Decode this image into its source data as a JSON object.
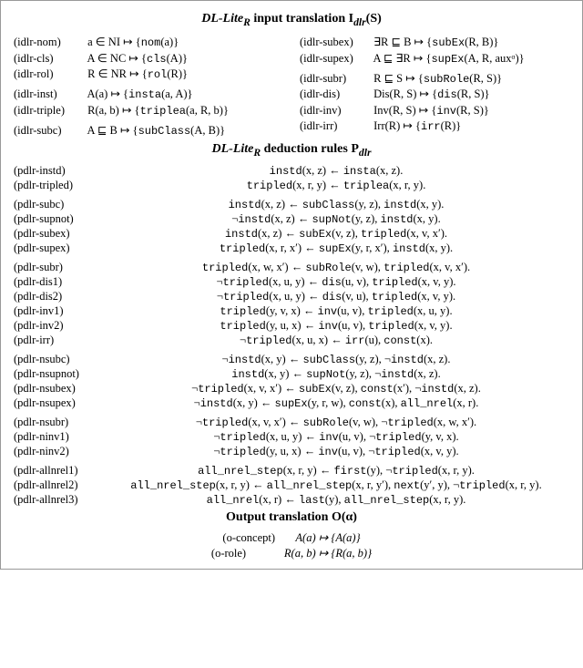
{
  "headings": {
    "input": "DL-Lite",
    "input_sub": "R",
    "input_tail": " input translation I",
    "input_tail_sub": "dlr",
    "input_tail2": "(S)",
    "rules": "DL-Lite",
    "rules_sub": "R",
    "rules_tail": " deduction rules P",
    "rules_tail_sub": "dlr",
    "output": "Output translation O(α)"
  },
  "left": [
    {
      "lab": "(idlr-nom)",
      "body": "a ∈ NI ↦ {nom(a)}"
    },
    {
      "lab": "(idlr-cls)",
      "body": "A ∈ NC ↦ {cls(A)}"
    },
    {
      "lab": "(idlr-rol)",
      "body": "R ∈ NR ↦ {rol(R)}"
    }
  ],
  "left2": [
    {
      "lab": "(idlr-inst)",
      "body": "A(a) ↦ {insta(a, A)}"
    },
    {
      "lab": "(idlr-triple)",
      "body": "R(a, b) ↦ {triplea(a, R, b)}"
    }
  ],
  "left3": [
    {
      "lab": "(idlr-subc)",
      "body": "A ⊑ B ↦ {subClass(A, B)}"
    }
  ],
  "right1": [
    {
      "lab": "(idlr-subex)",
      "body": "∃R ⊑ B ↦ {subEx(R, B)}"
    },
    {
      "lab": "(idlr-supex)",
      "body": "A ⊑ ∃R ↦ {supEx(A, R, auxᵅ)}"
    }
  ],
  "right2": [
    {
      "lab": "(idlr-subr)",
      "body": "R ⊑ S ↦ {subRole(R, S)}"
    },
    {
      "lab": "(idlr-dis)",
      "body": "Dis(R, S) ↦ {dis(R, S)}"
    },
    {
      "lab": "(idlr-inv)",
      "body": "Inv(R, S) ↦ {inv(R, S)}"
    },
    {
      "lab": "(idlr-irr)",
      "body": "Irr(R) ↦ {irr(R)}"
    }
  ],
  "rules": [
    {
      "lab": "(pdlr-instd)",
      "body": "instd(x, z) ← insta(x, z)."
    },
    {
      "lab": "(pdlr-tripled)",
      "body": "tripled(x, r, y) ← triplea(x, r, y)."
    }
  ],
  "rules2": [
    {
      "lab": "(pdlr-subc)",
      "body": "instd(x, z) ← subClass(y, z), instd(x, y)."
    },
    {
      "lab": "(pdlr-supnot)",
      "body": "¬instd(x, z) ← supNot(y, z), instd(x, y)."
    },
    {
      "lab": "(pdlr-subex)",
      "body": "instd(x, z) ← subEx(v, z), tripled(x, v, x′)."
    },
    {
      "lab": "(pdlr-supex)",
      "body": "tripled(x, r, x′) ← supEx(y, r, x′), instd(x, y)."
    }
  ],
  "rules3": [
    {
      "lab": "(pdlr-subr)",
      "body": "tripled(x, w, x′) ← subRole(v, w), tripled(x, v, x′)."
    },
    {
      "lab": "(pdlr-dis1)",
      "body": "¬tripled(x, u, y) ← dis(u, v), tripled(x, v, y)."
    },
    {
      "lab": "(pdlr-dis2)",
      "body": "¬tripled(x, u, y) ← dis(v, u), tripled(x, v, y)."
    },
    {
      "lab": "(pdlr-inv1)",
      "body": "tripled(y, v, x) ← inv(u, v), tripled(x, u, y)."
    },
    {
      "lab": "(pdlr-inv2)",
      "body": "tripled(y, u, x) ← inv(u, v), tripled(x, v, y)."
    },
    {
      "lab": "(pdlr-irr)",
      "body": "¬tripled(x, u, x) ← irr(u), const(x)."
    }
  ],
  "rules4": [
    {
      "lab": "(pdlr-nsubc)",
      "body": "¬instd(x, y) ← subClass(y, z), ¬instd(x, z)."
    },
    {
      "lab": "(pdlr-nsupnot)",
      "body": "instd(x, y) ← supNot(y, z), ¬instd(x, z)."
    },
    {
      "lab": "(pdlr-nsubex)",
      "body": "¬tripled(x, v, x′) ← subEx(v, z), const(x′), ¬instd(x, z)."
    },
    {
      "lab": "(pdlr-nsupex)",
      "body": "¬instd(x, y) ← supEx(y, r, w), const(x), all_nrel(x, r)."
    }
  ],
  "rules5": [
    {
      "lab": "(pdlr-nsubr)",
      "body": "¬tripled(x, v, x′) ← subRole(v, w), ¬tripled(x, w, x′)."
    },
    {
      "lab": "(pdlr-ninv1)",
      "body": "¬tripled(x, u, y) ← inv(u, v), ¬tripled(y, v, x)."
    },
    {
      "lab": "(pdlr-ninv2)",
      "body": "¬tripled(y, u, x) ← inv(u, v), ¬tripled(x, v, y)."
    }
  ],
  "rules6": [
    {
      "lab": "(pdlr-allnrel1)",
      "body": "all_nrel_step(x, r, y) ← first(y), ¬tripled(x, r, y)."
    },
    {
      "lab": "(pdlr-allnrel2)",
      "body": "all_nrel_step(x, r, y) ← all_nrel_step(x, r, y′), next(y′, y), ¬tripled(x, r, y)."
    },
    {
      "lab": "(pdlr-allnrel3)",
      "body": "all_nrel(x, r) ← last(y), all_nrel_step(x, r, y)."
    }
  ],
  "output": [
    {
      "lab": "(o-concept)",
      "body": "A(a) ↦ {A(a)}"
    },
    {
      "lab": "(o-role)",
      "body": "R(a, b) ↦ {R(a, b)}"
    }
  ]
}
